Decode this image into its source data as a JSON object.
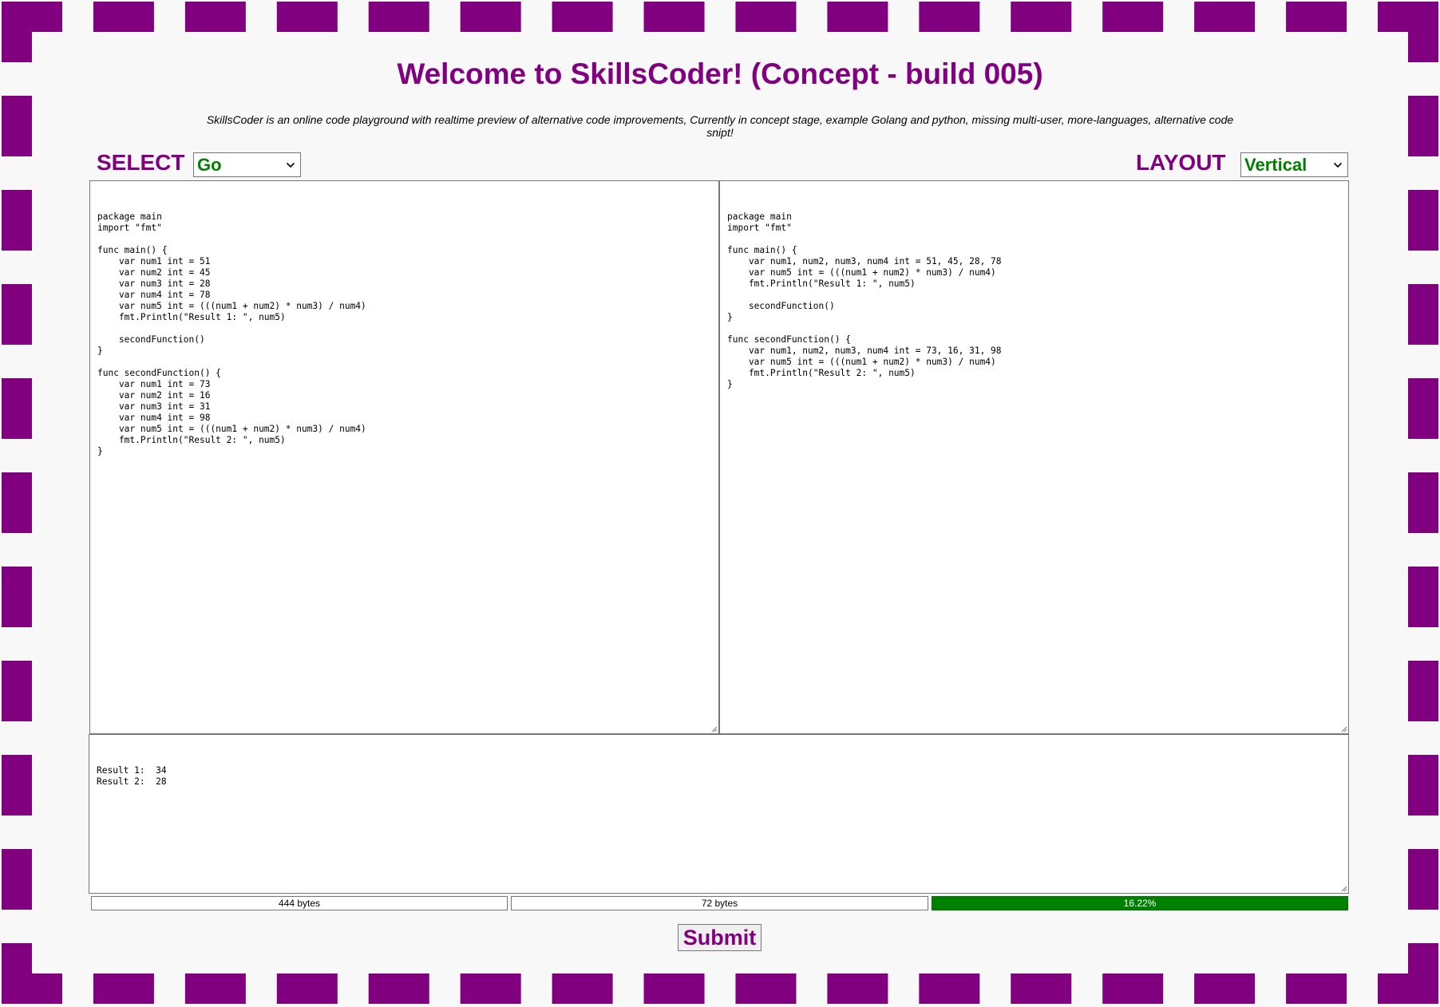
{
  "header": {
    "title": "Welcome to SkillsCoder! (Concept - build 005)",
    "subtitle": "SkillsCoder is an online code playground with realtime preview of alternative code improvements, Currently in concept stage, example Golang and python, missing multi-user, more-languages, alternative code snipt!"
  },
  "controls": {
    "select_label": "SELECT",
    "language_value": "Go",
    "layout_label": "LAYOUT",
    "layout_value": "Vertical"
  },
  "editors": {
    "source_code": "package main\nimport \"fmt\"\n\nfunc main() {\n    var num1 int = 51\n    var num2 int = 45\n    var num3 int = 28\n    var num4 int = 78\n    var num5 int = (((num1 + num2) * num3) / num4)\n    fmt.Println(\"Result 1: \", num5)\n\n    secondFunction()\n}\n\nfunc secondFunction() {\n    var num1 int = 73\n    var num2 int = 16\n    var num3 int = 31\n    var num4 int = 98\n    var num5 int = (((num1 + num2) * num3) / num4)\n    fmt.Println(\"Result 2: \", num5)\n}",
    "improved_code": "package main\nimport \"fmt\"\n\nfunc main() {\n    var num1, num2, num3, num4 int = 51, 45, 28, 78\n    var num5 int = (((num1 + num2) * num3) / num4)\n    fmt.Println(\"Result 1: \", num5)\n\n    secondFunction()\n}\n\nfunc secondFunction() {\n    var num1, num2, num3, num4 int = 73, 16, 31, 98\n    var num5 int = (((num1 + num2) * num3) / num4)\n    fmt.Println(\"Result 2: \", num5)\n}"
  },
  "output": {
    "text": "Result 1:  34\nResult 2:  28"
  },
  "stats": {
    "original_size": "444 bytes",
    "improved_size": "72 bytes",
    "ratio": "16.22%",
    "ratio_fraction": 1.0
  },
  "submit_label": "Submit",
  "colors": {
    "brand": "#800080",
    "accent": "#008000"
  },
  "icons": {
    "dropdown": "chevron-down-icon",
    "resize": "resize-grip-icon"
  }
}
